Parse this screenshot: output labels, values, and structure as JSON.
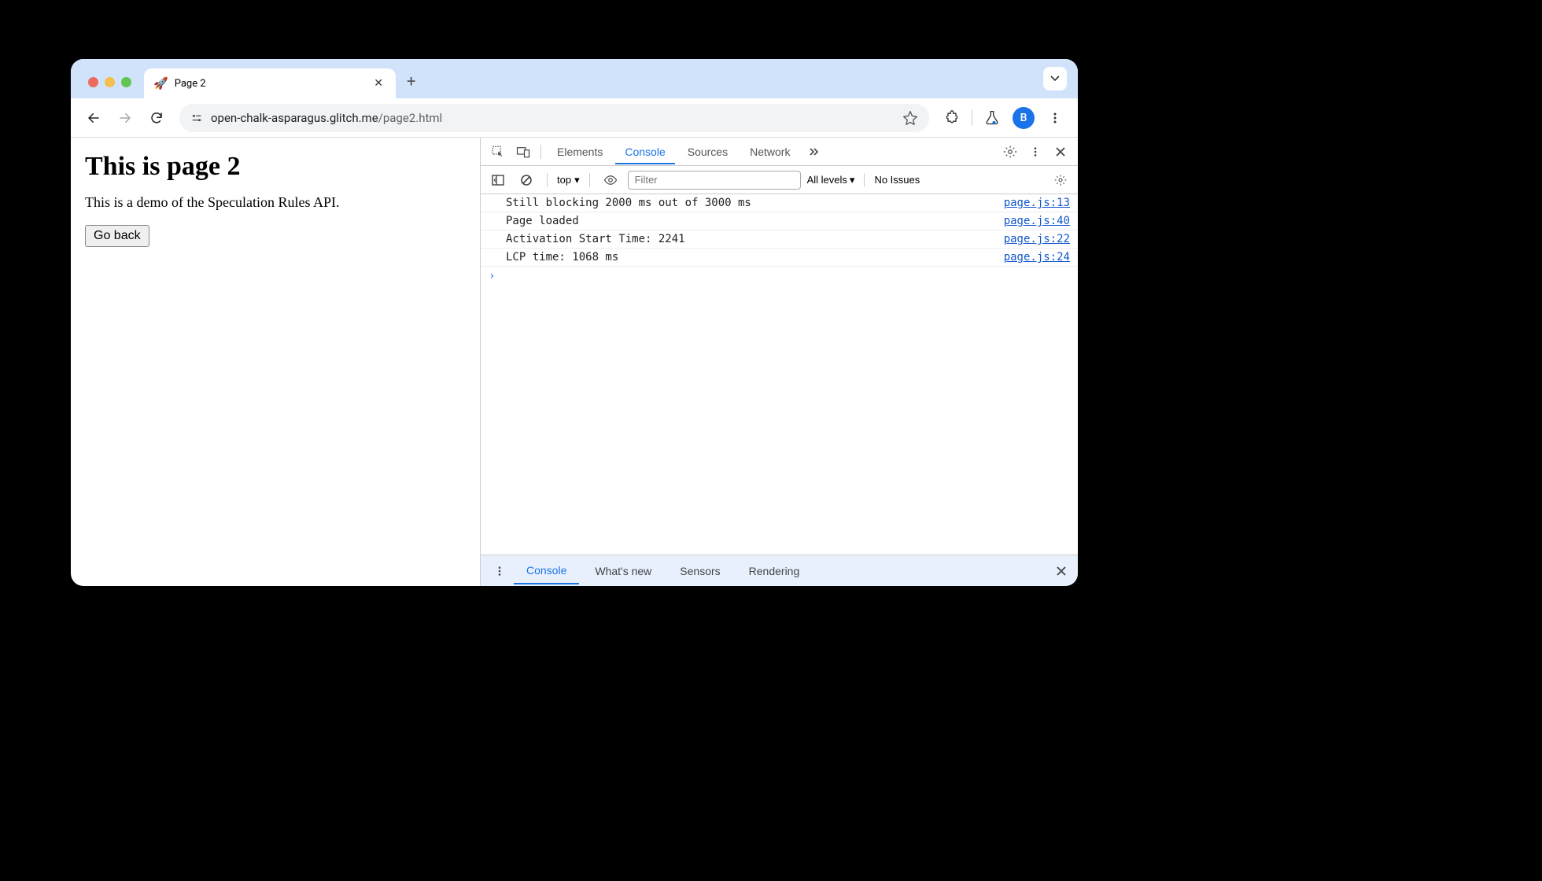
{
  "browser": {
    "tab": {
      "favicon": "🚀",
      "title": "Page 2"
    },
    "url": {
      "host": "open-chalk-asparagus.glitch.me",
      "path": "/page2.html"
    },
    "avatar_letter": "B"
  },
  "page": {
    "heading": "This is page 2",
    "paragraph": "This is a demo of the Speculation Rules API.",
    "go_back_label": "Go back"
  },
  "devtools": {
    "tabs": {
      "elements": "Elements",
      "console": "Console",
      "sources": "Sources",
      "network": "Network"
    },
    "console_toolbar": {
      "context": "top",
      "filter_placeholder": "Filter",
      "levels": "All levels",
      "issues": "No Issues"
    },
    "logs": [
      {
        "msg": "Still blocking 2000 ms out of 3000 ms",
        "src": "page.js:13"
      },
      {
        "msg": "Page loaded",
        "src": "page.js:40"
      },
      {
        "msg": "Activation Start Time: 2241",
        "src": "page.js:22"
      },
      {
        "msg": "LCP time: 1068 ms",
        "src": "page.js:24"
      }
    ],
    "drawer": {
      "console": "Console",
      "whats_new": "What's new",
      "sensors": "Sensors",
      "rendering": "Rendering"
    }
  }
}
